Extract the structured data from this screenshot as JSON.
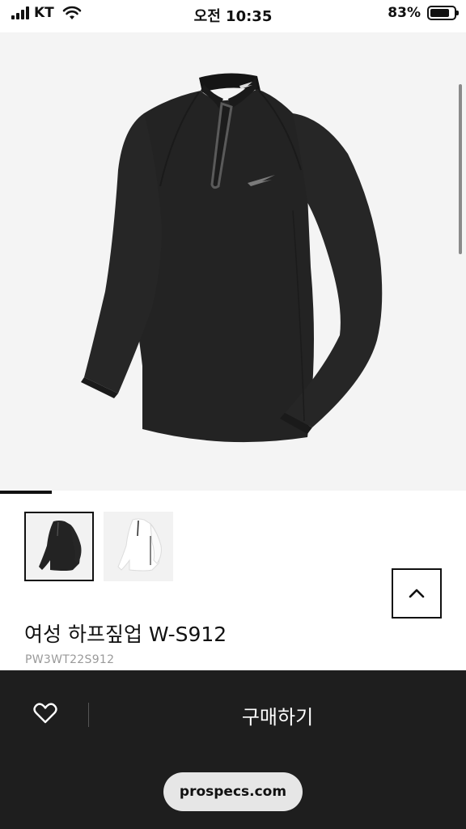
{
  "status_bar": {
    "carrier": "KT",
    "time": "오전 10:35",
    "battery_percent": "83%",
    "battery_level": 0.83,
    "icons": [
      "signal-icon",
      "wifi-icon",
      "battery-icon"
    ]
  },
  "gallery": {
    "main_image": "black-half-zip-long-sleeve-shirt",
    "slide_index": 1,
    "slide_count": 9,
    "thumbnails": [
      {
        "image": "black-shirt-thumbnail",
        "selected": true
      },
      {
        "image": "white-shirt-thumbnail",
        "selected": false
      }
    ]
  },
  "scroll_top_icon": "chevron-up-icon",
  "product": {
    "name": "여성 하프짚업 W-S912",
    "code": "PW3WT22S912"
  },
  "bottom_bar": {
    "wish_icon": "heart-icon",
    "buy_label": "구매하기",
    "url": "prospecs.com"
  },
  "colors": {
    "bottom_bar": "#1e1e1e",
    "hero_background": "#f4f4f4",
    "garment_black": "#222222"
  }
}
